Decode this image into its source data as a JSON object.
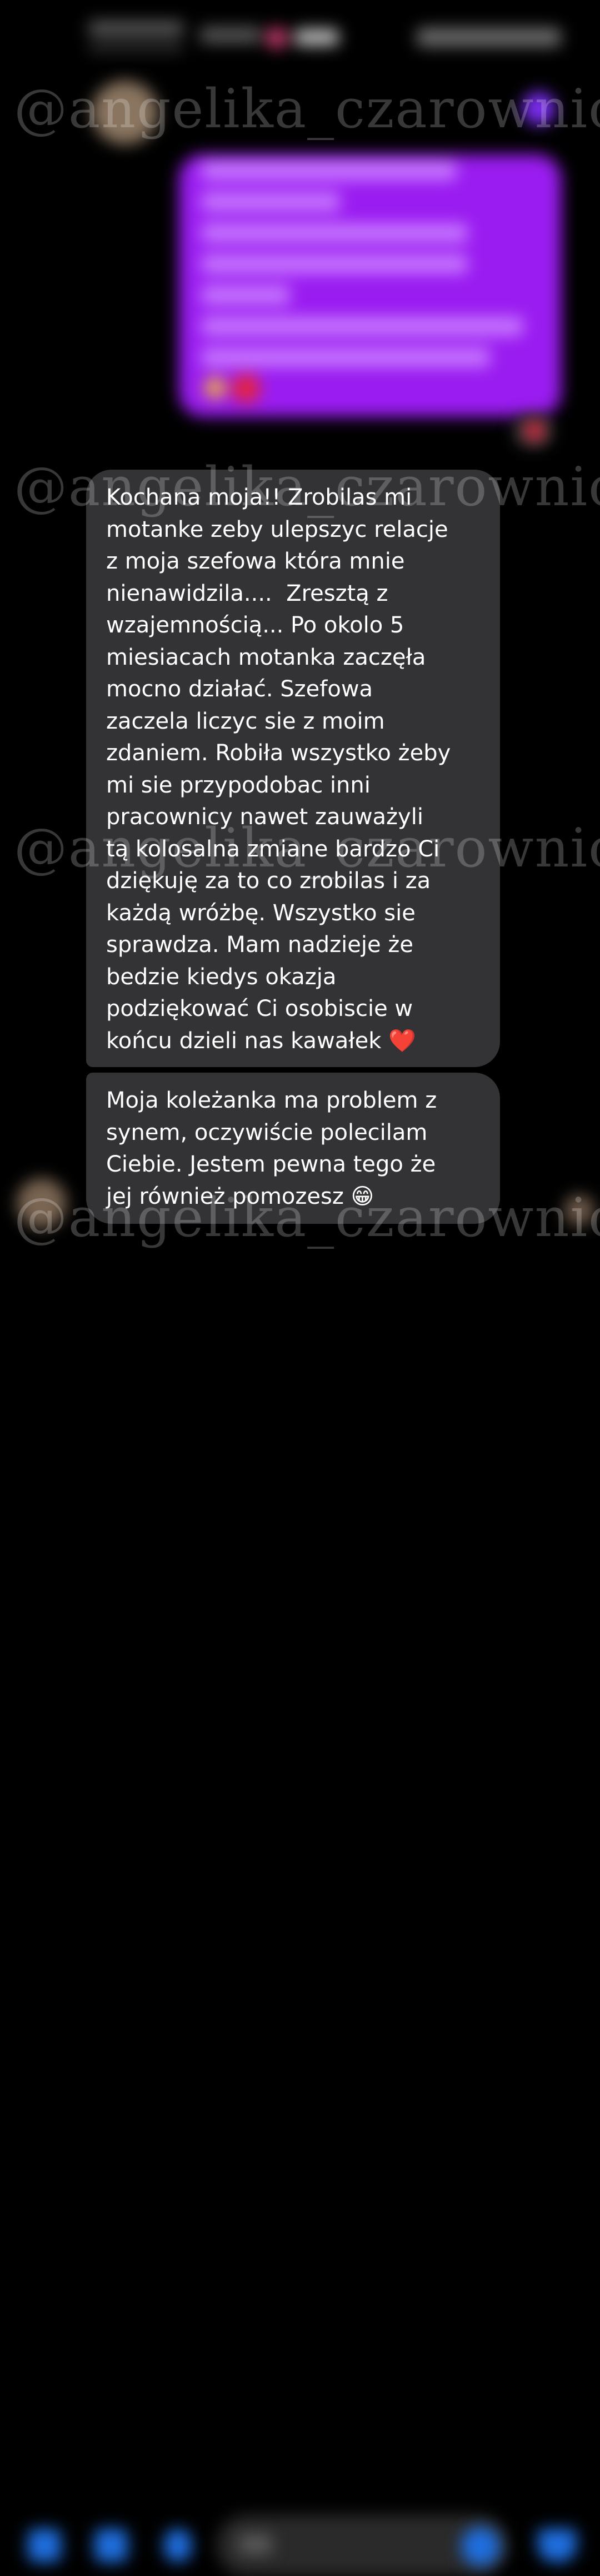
{
  "thread": {
    "received_messages": [
      {
        "text": "Kochana moja!! Zrobilas mi\nmotanke zeby ulepszyc relacje\nz moja szefowa która mnie\nnienawidzila....  Zresztą z\nwzajemnością... Po okolo 5\nmiesiacach motanka zaczęła\nmocno działać. Szefowa\nzaczela liczyc sie z moim\nzdaniem. Robiła wszystko żeby\nmi sie przypodobac inni\npracownicy nawet zauważyli\ntą kolosalna zmiane bardzo Ci\ndziękuję za to co zrobilas i za\nkażdą wróżbę. Wszystko sie\nsprawdza. Mam nadzieje że\nbedzie kiedys okazja\npodziękować Ci osobiscie w\nkońcu dzieli nas kawałek ❤️"
      },
      {
        "text": "Moja koleżanka ma problem z\nsynem, oczywiście polecilam\nCiebie. Jestem pewna tego że\njej również pomozesz 😁"
      }
    ]
  },
  "watermark": {
    "text": "@angelika_czarownica"
  },
  "colors": {
    "sent_bubble": "#9a1cf0",
    "received_bubble": "#333335",
    "accent": "#1f6fe0",
    "background": "#000000"
  },
  "icons": {
    "composer": [
      "camera-icon",
      "gallery-icon",
      "mic-icon",
      "emoji-icon",
      "like-icon"
    ],
    "reaction": "heart-icon"
  }
}
